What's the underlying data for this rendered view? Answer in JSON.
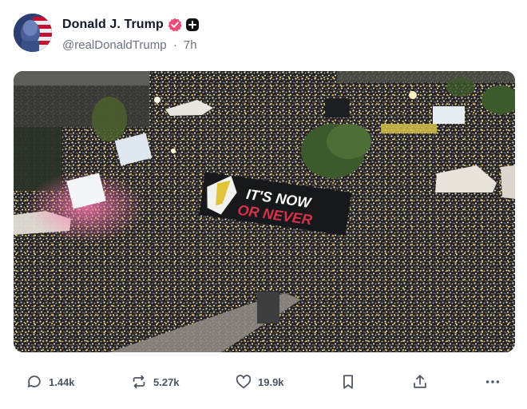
{
  "post": {
    "author": {
      "display_name": "Donald J. Trump",
      "handle": "@realDonaldTrump",
      "separator": "·",
      "time": "7h"
    },
    "media": {
      "banner_line1": "IT'S NOW",
      "banner_line2": "OR NEVER"
    },
    "actions": {
      "replies": "1.44k",
      "reposts": "5.27k",
      "likes": "19.9k"
    }
  },
  "colors": {
    "verified_badge": "#ec4c7c",
    "text_primary": "#111827",
    "text_muted": "#6b7280"
  },
  "icons": [
    "verified-badge-icon",
    "plus-badge-icon",
    "reply-icon",
    "repost-icon",
    "like-icon",
    "bookmark-icon",
    "share-icon",
    "more-icon"
  ]
}
